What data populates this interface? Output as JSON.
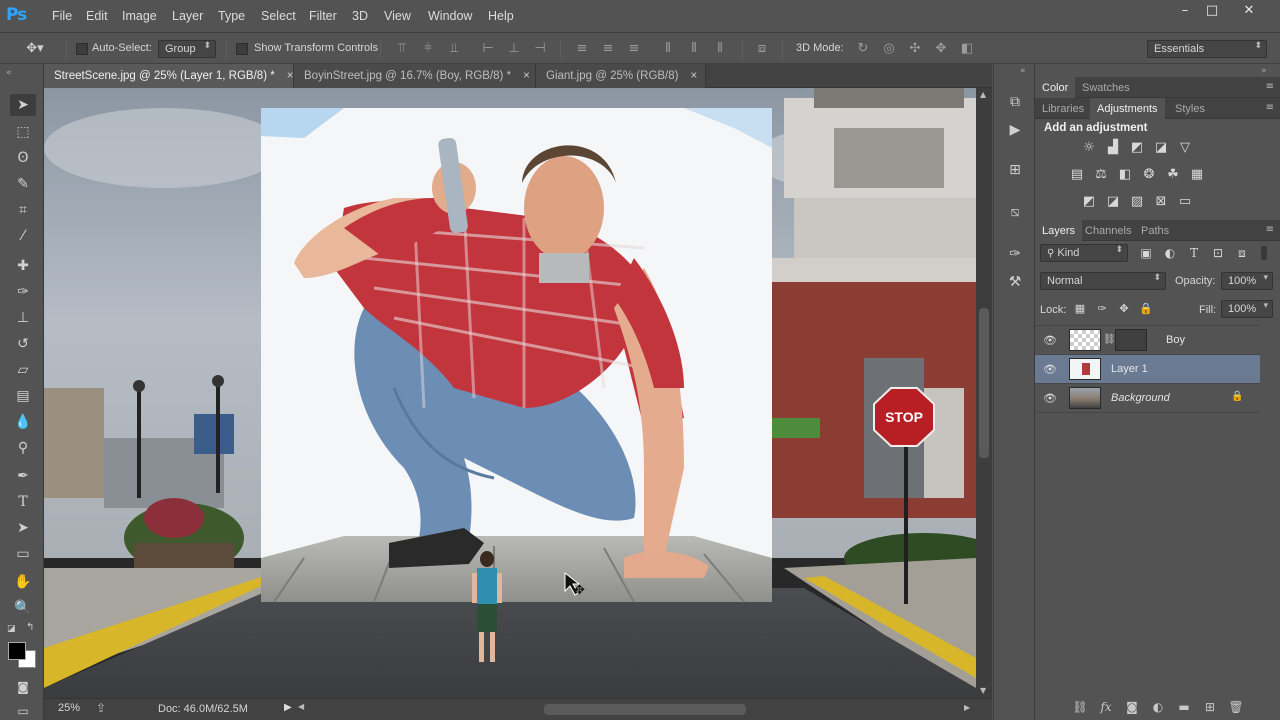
{
  "app": {
    "logo": "Ps"
  },
  "menu": [
    "File",
    "Edit",
    "Image",
    "Layer",
    "Type",
    "Select",
    "Filter",
    "3D",
    "View",
    "Window",
    "Help"
  ],
  "window_controls": {
    "minimize": "–",
    "maximize": "□",
    "close": "✕"
  },
  "options": {
    "auto_select_label": "Auto-Select:",
    "auto_select_value": "Group",
    "transform_label": "Show Transform Controls",
    "mode_3d_label": "3D Mode:",
    "workspace": "Essentials"
  },
  "tabs": [
    {
      "label": "StreetScene.jpg @ 25% (Layer 1, RGB/8) *",
      "close": "×",
      "active": true
    },
    {
      "label": "BoyinStreet.jpg @ 16.7% (Boy, RGB/8) *",
      "close": "×",
      "active": false
    },
    {
      "label": "Giant.jpg @ 25% (RGB/8)",
      "close": "×",
      "active": false
    }
  ],
  "status": {
    "zoom": "25%",
    "doc": "Doc: 46.0M/62.5M"
  },
  "canvas": {
    "stop_sign": "STOP"
  },
  "color_panel": {
    "tabs": [
      "Color",
      "Swatches"
    ]
  },
  "adjust_panel": {
    "tabs": [
      "Libraries",
      "Adjustments",
      "Styles"
    ],
    "title": "Add an adjustment"
  },
  "layers_panel": {
    "tabs": [
      "Layers",
      "Channels",
      "Paths"
    ],
    "filter": "Kind",
    "blend_mode": "Normal",
    "opacity_label": "Opacity:",
    "opacity_value": "100%",
    "lock_label": "Lock:",
    "fill_label": "Fill:",
    "fill_value": "100%",
    "layers": [
      {
        "name": "Boy",
        "selected": false,
        "locked": false
      },
      {
        "name": "Layer 1",
        "selected": true,
        "locked": false
      },
      {
        "name": "Background",
        "selected": false,
        "locked": true
      }
    ]
  },
  "colors": {
    "accent": "#2fa3ff",
    "selected_layer": "#6b7a93",
    "stop_red": "#b81f24"
  }
}
